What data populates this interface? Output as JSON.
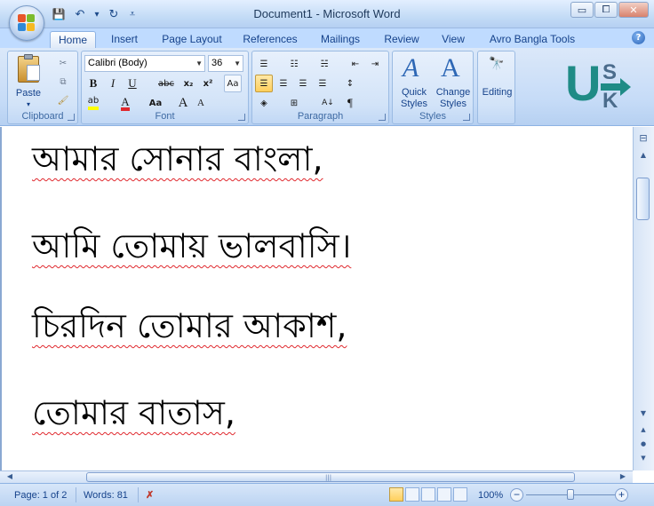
{
  "window": {
    "title": "Document1 - Microsoft Word",
    "minimize_glyph": "▭",
    "maximize_glyph": "⧠",
    "close_glyph": "✕"
  },
  "qat": {
    "save_glyph": "💾",
    "undo_glyph": "↶",
    "undo_dropdown_glyph": "▾",
    "redo_glyph": "↻",
    "customize_glyph": "⩡"
  },
  "tabs": [
    {
      "label": "Home",
      "active": true
    },
    {
      "label": "Insert"
    },
    {
      "label": "Page Layout"
    },
    {
      "label": "References"
    },
    {
      "label": "Mailings"
    },
    {
      "label": "Review"
    },
    {
      "label": "View"
    },
    {
      "label": "Avro Bangla Tools"
    }
  ],
  "help_glyph": "?",
  "ribbon": {
    "clipboard": {
      "label": "Clipboard",
      "paste_label": "Paste",
      "paste_arrow": "▾",
      "cut_glyph": "✂",
      "copy_glyph": "⧉",
      "format_painter_glyph": "🖌"
    },
    "font": {
      "label": "Font",
      "font_name": "Calibri (Body)",
      "font_size": "36",
      "dropdown_glyph": "▼",
      "bold": "B",
      "italic": "I",
      "underline": "U",
      "strikethrough": "abc",
      "subscript": "x₂",
      "superscript": "x²",
      "clear_format_glyph": "Aa",
      "highlight_glyph": "ab",
      "font_color_glyph": "A",
      "change_case": "Aa",
      "grow_font": "A",
      "shrink_font": "A",
      "highlight_color": "#ffff00",
      "font_color": "#e0282d"
    },
    "paragraph": {
      "label": "Paragraph",
      "bullets_glyph": "☰",
      "numbering_glyph": "☷",
      "multilevel_glyph": "☵",
      "decrease_indent_glyph": "⇤",
      "increase_indent_glyph": "⇥",
      "align_left_glyph": "☰",
      "center_glyph": "☰",
      "align_right_glyph": "☰",
      "justify_glyph": "☰",
      "line_spacing_glyph": "↕",
      "shading_glyph": "◈",
      "borders_glyph": "⊞",
      "sort_glyph": "A↓",
      "pilcrow_glyph": "¶"
    },
    "styles": {
      "label": "Styles",
      "quick_styles_line1": "Quick",
      "quick_styles_line2": "Styles",
      "change_styles_line1": "Change",
      "change_styles_line2": "Styles",
      "big_glyph": "A"
    },
    "editing": {
      "label": "Editing",
      "glyph": "🔭"
    },
    "logo": {
      "letter_u": "U",
      "letter_s": "S",
      "letter_k": "K"
    }
  },
  "document": {
    "lines": [
      "আমার সোনার বাংলা,",
      "আমি তোমায় ভালবাসি।",
      "চিরদিন তোমার আকাশ,",
      "তোমার বাতাস,"
    ]
  },
  "scrollbar": {
    "up_glyph": "▲",
    "down_glyph": "▼",
    "left_glyph": "◀",
    "right_glyph": "▶",
    "prev_page_glyph": "▲",
    "select_browse_glyph": "●",
    "next_page_glyph": "▼",
    "ruler_glyph": "⊟",
    "grip_glyph": "|||"
  },
  "status": {
    "page": "Page: 1 of 2",
    "words": "Words: 81",
    "proofing_glyph": "✗",
    "zoom": "100%",
    "zoom_out_glyph": "−",
    "zoom_in_glyph": "+",
    "zoom_level_fraction": 0.5
  }
}
